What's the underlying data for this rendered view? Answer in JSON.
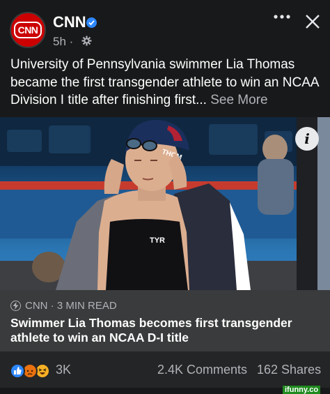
{
  "header": {
    "avatar_text": "CNN",
    "page_name": "CNN",
    "timestamp": "5h ·",
    "icons": [
      "verified-icon",
      "globe-icon",
      "more-icon",
      "close-icon"
    ]
  },
  "post": {
    "caption": "University of Pennsylvania swimmer Lia Thomas became the first transgender athlete to win an NCAA Division I title after finishing first...",
    "see_more": "See More"
  },
  "photo": {
    "swim_cap_text": "THOM",
    "suit_logo": "TYR",
    "info_icon": "i"
  },
  "link_card": {
    "source": "CNN · 3 MIN READ",
    "headline": "Swimmer Lia Thomas becomes first transgender athlete to win an NCAA D-I title"
  },
  "stats": {
    "reaction_count": "3K",
    "comments": "2.4K Comments",
    "shares": "162 Shares"
  },
  "watermark": "ifunny.co",
  "colors": {
    "background": "#18191a",
    "card": "#3a3b3c",
    "accent": "#2d88ff",
    "cnn_red": "#cc0000"
  }
}
